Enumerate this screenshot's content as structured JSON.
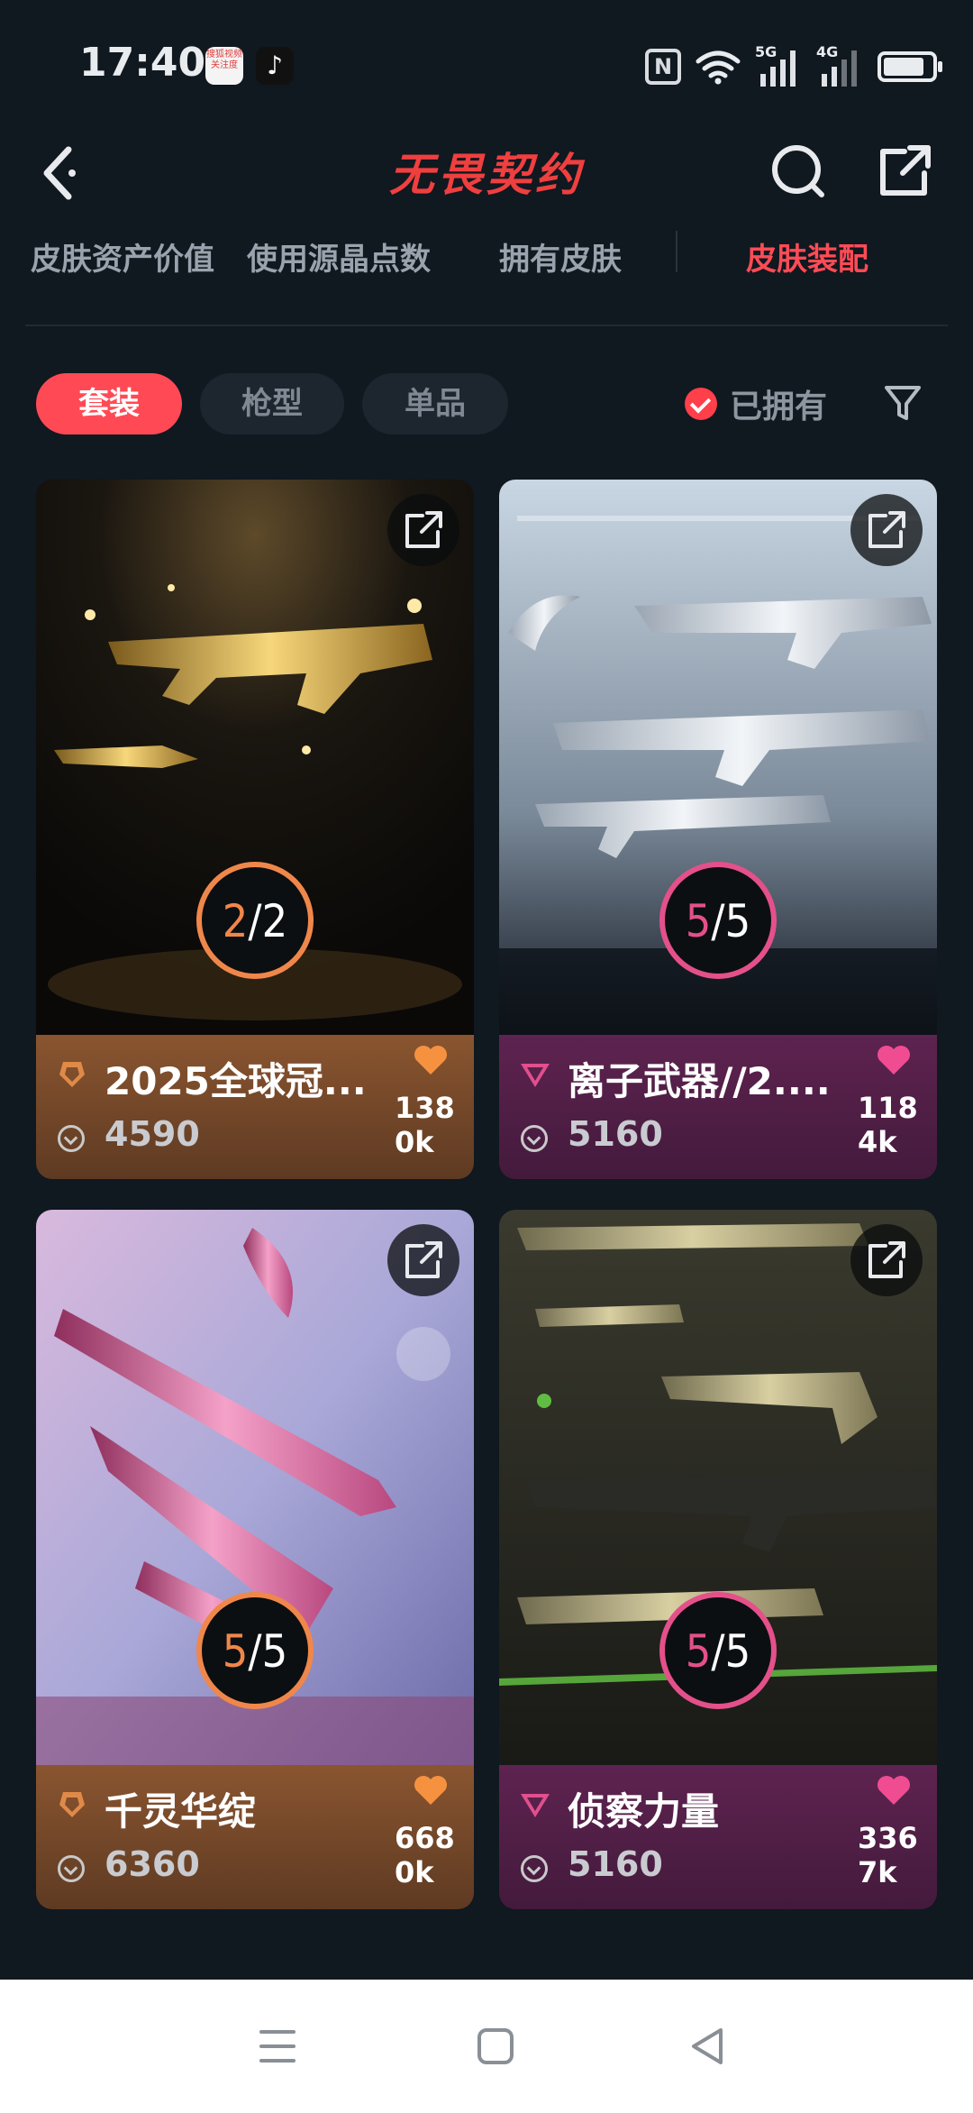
{
  "status_bar": {
    "time": "17:40",
    "news_icon_text": "搜狐视频 关注度",
    "network_1": "5G",
    "network_2": "4G"
  },
  "header": {
    "title": "无畏契约"
  },
  "tabs": [
    {
      "label": "皮肤资产价值"
    },
    {
      "label": "使用源晶点数"
    },
    {
      "label": "拥有皮肤"
    },
    {
      "label": "皮肤装配",
      "active": true
    }
  ],
  "filters": {
    "chips": [
      {
        "label": "套装",
        "active": true
      },
      {
        "label": "枪型"
      },
      {
        "label": "单品"
      }
    ],
    "owned_label": "已拥有"
  },
  "cards": [
    {
      "name": "2025全球冠...",
      "price": "4590",
      "likes": "1380k",
      "owned": "2",
      "total": "2",
      "tier": "orange"
    },
    {
      "name": "离子武器//2....",
      "price": "5160",
      "likes": "1184k",
      "owned": "5",
      "total": "5",
      "tier": "pink"
    },
    {
      "name": "千灵华绽",
      "price": "6360",
      "likes": "6680k",
      "owned": "5",
      "total": "5",
      "tier": "orange"
    },
    {
      "name": "侦察力量",
      "price": "5160",
      "likes": "3367k",
      "owned": "5",
      "total": "5",
      "tier": "pink"
    }
  ],
  "colors": {
    "accent": "#ff4a55",
    "orange_tier": "#f0874a",
    "pink_tier": "#e4508a",
    "background": "#101820"
  }
}
